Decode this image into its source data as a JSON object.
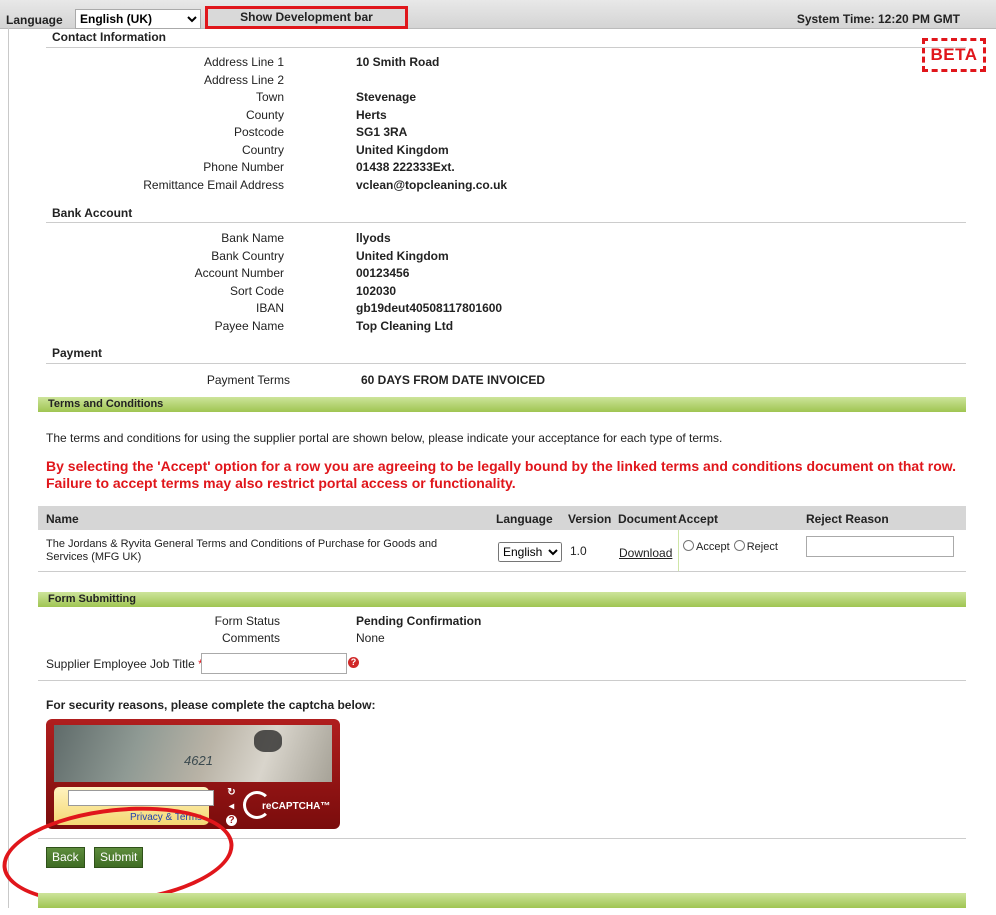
{
  "topbar": {
    "language_label": "Language",
    "language_value": "English (UK)",
    "dev_bar_label": "Show Development bar",
    "system_time": "System Time: 12:20 PM GMT"
  },
  "beta_badge": "BETA",
  "contact": {
    "title": "Contact Information",
    "fields": [
      {
        "label": "Address Line 1",
        "value": "10 Smith Road"
      },
      {
        "label": "Address Line 2",
        "value": ""
      },
      {
        "label": "Town",
        "value": "Stevenage"
      },
      {
        "label": "County",
        "value": "Herts"
      },
      {
        "label": "Postcode",
        "value": "SG1 3RA"
      },
      {
        "label": "Country",
        "value": "United Kingdom"
      },
      {
        "label": "Phone Number",
        "value": "01438 222333Ext."
      },
      {
        "label": "Remittance Email Address",
        "value": "vclean@topcleaning.co.uk"
      }
    ]
  },
  "bank": {
    "title": "Bank Account",
    "fields": [
      {
        "label": "Bank Name",
        "value": "llyods"
      },
      {
        "label": "Bank Country",
        "value": "United Kingdom"
      },
      {
        "label": "Account Number",
        "value": "00123456"
      },
      {
        "label": "Sort Code",
        "value": "102030"
      },
      {
        "label": "IBAN",
        "value": "gb19deut40508117801600"
      },
      {
        "label": "Payee Name",
        "value": "Top Cleaning Ltd"
      }
    ]
  },
  "payment": {
    "title": "Payment",
    "label": "Payment Terms",
    "value": "60 DAYS FROM DATE INVOICED"
  },
  "terms": {
    "bar_title": "Terms and Conditions",
    "intro": "The terms and conditions for using the supplier portal are shown below, please indicate your acceptance for each type of terms.",
    "warning_line1": "By selecting the 'Accept' option for a row you are agreeing to be legally bound by the linked terms and conditions document on that row.",
    "warning_line2": "Failure to accept terms may also restrict portal access or functionality.",
    "columns": {
      "name": "Name",
      "language": "Language",
      "version": "Version",
      "document": "Document",
      "accept": "Accept",
      "reject_reason": "Reject Reason"
    },
    "row": {
      "name": "The Jordans & Ryvita General Terms and Conditions of Purchase for Goods and Services (MFG UK)",
      "language": "English",
      "version": "1.0",
      "document": "Download",
      "accept_label": "Accept",
      "reject_label": "Reject"
    }
  },
  "form": {
    "bar_title": "Form Submitting",
    "status_label": "Form Status",
    "status_value": "Pending Confirmation",
    "comments_label": "Comments",
    "comments_value": "None",
    "job_title_label": "Supplier Employee Job Title",
    "required_mark": "*"
  },
  "captcha": {
    "title": "For security reasons, please complete the captcha below:",
    "image_text": "4621",
    "privacy": "Privacy & Terms",
    "brand": "reCAPTCHA™"
  },
  "buttons": {
    "back": "Back",
    "submit": "Submit"
  }
}
